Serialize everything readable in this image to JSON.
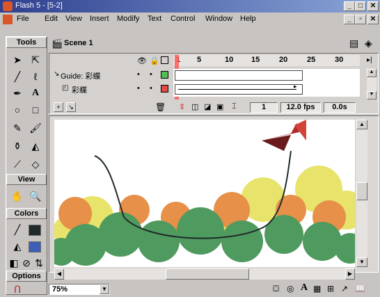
{
  "window": {
    "title": "Flash 5 - [5-2]"
  },
  "menu": [
    "File",
    "Edit",
    "View",
    "Insert",
    "Modify",
    "Text",
    "Control",
    "Window",
    "Help"
  ],
  "tools": {
    "title": "Tools",
    "view_label": "View",
    "colors_label": "Colors",
    "options_label": "Options"
  },
  "scene": {
    "label": "Scene 1"
  },
  "timeline": {
    "frame_numbers": [
      "1",
      "5",
      "10",
      "15",
      "20",
      "25",
      "30"
    ],
    "layers": [
      {
        "name": "Guide: 彩蝶"
      },
      {
        "name": "彩蝶"
      }
    ],
    "current_frame": "1",
    "fps": "12.0 fps",
    "time": "0.0s"
  },
  "status": {
    "zoom": "75%"
  },
  "colors": {
    "title_start": "#2e3f8f",
    "title_end": "#8aa6d8",
    "fill_green": "#4f9a5e",
    "fill_orange": "#e6904a",
    "fill_yellow": "#e8e36a",
    "stroke": "#1f2a2a",
    "butterfly": "#b32b2e"
  }
}
